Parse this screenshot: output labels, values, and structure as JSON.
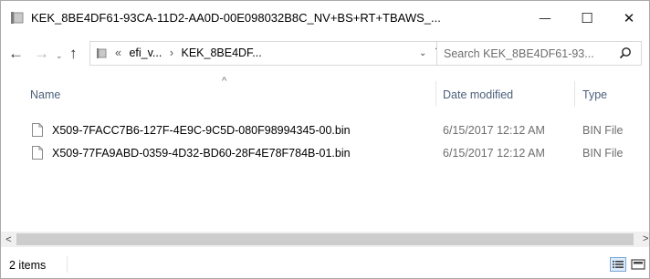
{
  "window": {
    "title": "KEK_8BE4DF61-93CA-11D2-AA0D-00E098032B8C_NV+BS+RT+TBAWS_...",
    "controls": {
      "minimize": "—",
      "maximize": "☐",
      "close": "✕"
    }
  },
  "navigation": {
    "back": "←",
    "forward": "→",
    "recent": "⌄",
    "up": "↑",
    "breadcrumb": {
      "overflow": "«",
      "parent": "efi_v...",
      "separator": "›",
      "current": "KEK_8BE4DF..."
    },
    "dropdown": "⌄",
    "refresh": "↻"
  },
  "search": {
    "placeholder": "Search KEK_8BE4DF61-93..."
  },
  "columns": {
    "name": "Name",
    "date_modified": "Date modified",
    "type": "Type"
  },
  "sort_caret": "^",
  "files": [
    {
      "name": "X509-7FACC7B6-127F-4E9C-9C5D-080F98994345-00.bin",
      "date": "6/15/2017 12:12 AM",
      "type": "BIN File"
    },
    {
      "name": "X509-77FA9ABD-0359-4D32-BD60-28F4E78F784B-01.bin",
      "date": "6/15/2017 12:12 AM",
      "type": "BIN File"
    }
  ],
  "scrollbar": {
    "left_arrow": "<",
    "right_arrow": ">"
  },
  "status": {
    "item_count": "2 items"
  },
  "colors": {
    "header_text": "#4c607a",
    "secondary_text": "#6d6d6d",
    "view_active": "#dcebfc"
  },
  "icons": [
    "folder-icon",
    "search-icon",
    "file-icon",
    "details-view-icon",
    "large-icons-view-icon"
  ]
}
